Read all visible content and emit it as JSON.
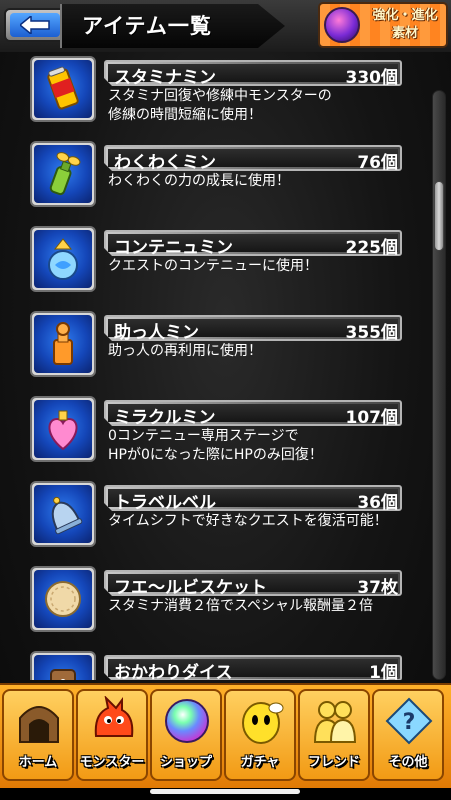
{
  "header": {
    "title": "アイテム一覧",
    "upgrade_line1": "強化・進化",
    "upgrade_line2": "素材",
    "back_icon": "back-arrow-icon"
  },
  "items": [
    {
      "name": "スタミナミン",
      "count": "330個",
      "desc": "スタミナ回復や修練中モンスターの\n修練の時間短縮に使用！",
      "icon": "stamina-can-icon"
    },
    {
      "name": "わくわくミン",
      "count": "76個",
      "desc": "わくわくの力の成長に使用！",
      "icon": "sprout-bottle-icon"
    },
    {
      "name": "コンテニュミン",
      "count": "225個",
      "desc": "クエストのコンテニューに使用！",
      "icon": "continue-flask-icon"
    },
    {
      "name": "助っ人ミン",
      "count": "355個",
      "desc": "助っ人の再利用に使用！",
      "icon": "helper-bottle-icon"
    },
    {
      "name": "ミラクルミン",
      "count": "107個",
      "desc": "0コンテニュー専用ステージで\nHPが0になった際にHPのみ回復！",
      "icon": "heart-bottle-icon"
    },
    {
      "name": "トラベルベル",
      "count": "36個",
      "desc": "タイムシフトで好きなクエストを復活可能！",
      "icon": "bell-icon"
    },
    {
      "name": "フエ〜ルビスケット",
      "count": "37枚",
      "desc": "スタミナ消費２倍でスペシャル報酬量２倍",
      "icon": "biscuit-icon"
    },
    {
      "name": "おかわりダイス",
      "count": "1個",
      "desc": "",
      "icon": "dice-icon"
    }
  ],
  "nav": [
    {
      "label": "ホーム",
      "icon": "home-icon"
    },
    {
      "label": "モンスター",
      "icon": "monster-icon"
    },
    {
      "label": "ショップ",
      "icon": "shop-orb-icon"
    },
    {
      "label": "ガチャ",
      "icon": "gacha-egg-icon"
    },
    {
      "label": "フレンド",
      "icon": "friend-icon"
    },
    {
      "label": "その他",
      "icon": "other-question-icon"
    }
  ]
}
